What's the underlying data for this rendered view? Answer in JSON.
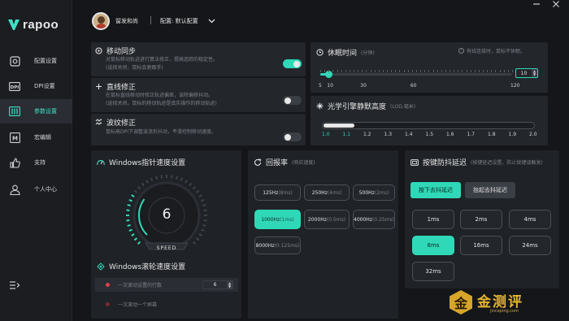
{
  "brand": {
    "name": "RAPOO"
  },
  "sidebar": {
    "items": [
      {
        "label": "配置设置",
        "icon": "settings-icon"
      },
      {
        "label": "DPI设置",
        "icon": "dpi-icon"
      },
      {
        "label": "参数设置",
        "icon": "parameter-icon",
        "active": true
      },
      {
        "label": "宏编辑",
        "icon": "macro-icon"
      },
      {
        "label": "支持",
        "icon": "thumbs-up-icon"
      },
      {
        "label": "个人中心",
        "icon": "user-icon"
      }
    ],
    "expand_icon": "menu-expand-icon"
  },
  "header": {
    "username": "留发和尚",
    "config_label": "配置: 默认配置"
  },
  "motion_sync": {
    "title": "移动同步",
    "desc1": "对鼠标移动轨迹进行算法修正，提高追踪的稳定性。",
    "desc2": "(选择关闭，鼠标会更跟手)",
    "enabled": true
  },
  "angle_snap": {
    "title": "直线修正",
    "desc1": "在鼠标直线移动时修正轨迹偏差，该除偏移抖动。",
    "desc2": "(选择关闭，鼠标的移动轨迹是真实操作的移动轨迹)",
    "enabled": false
  },
  "ripple": {
    "title": "波纹修正",
    "desc1": "鼠标高DPI下调整波浪形抖动，平滑控制移动速度。",
    "enabled": false
  },
  "sleep": {
    "title": "休眠时间",
    "unit": "(分钟)",
    "hint": "有线连接时，鼠标不休眠。",
    "value": "10",
    "current": 10,
    "min": 5,
    "max": 120,
    "ticks": [
      "5",
      "10",
      "30",
      "60",
      "120"
    ]
  },
  "lod": {
    "title": "光学引擎静默高度",
    "unit": "(LOD,毫米)",
    "current": 1.1,
    "ticks": [
      "1.0",
      "1.1",
      "1.2",
      "1.3",
      "1.4",
      "1.5",
      "1.6",
      "1.7",
      "1.8",
      "1.9",
      "2.0"
    ]
  },
  "pointer_speed": {
    "title": "Windows指针速度设置",
    "value": "6",
    "caption": "SPEED",
    "max": 20
  },
  "scroll_speed": {
    "title": "Windows滚轮速度设置",
    "row1_label": "一次滚动设置的行数",
    "row1_value": "6",
    "row2_label": "一次滚动一个屏幕"
  },
  "polling": {
    "title": "回报率",
    "subtitle": "(响应速度)",
    "options": [
      {
        "value": "125Hz",
        "unit": "(8ms)"
      },
      {
        "value": "250Hz",
        "unit": "(4ms)"
      },
      {
        "value": "500Hz",
        "unit": "(2ms)"
      },
      {
        "value": "1000Hz",
        "unit": "(1ms)",
        "selected": true
      },
      {
        "value": "2000Hz",
        "unit": "(0.5ms)"
      },
      {
        "value": "4000Hz",
        "unit": "(0.25ms)"
      },
      {
        "value": "8000Hz",
        "unit": "(0.125ms)"
      }
    ]
  },
  "debounce": {
    "title": "按键防抖延迟",
    "subtitle": "(按键延迟设置，防止按键误触发)",
    "press_label": "按下去抖延迟",
    "release_label": "抬起去抖延迟",
    "options": [
      "1ms",
      "2ms",
      "4ms",
      "8ms",
      "16ms",
      "24ms",
      "32ms"
    ],
    "selected": "8ms"
  },
  "watermark": {
    "text": "金测评",
    "url": "jinceping.com",
    "glyph": "金"
  },
  "colors": {
    "accent": "#2fd9b8",
    "background": "#141619",
    "panel": "#23262b",
    "indicator": "#e0424a"
  }
}
